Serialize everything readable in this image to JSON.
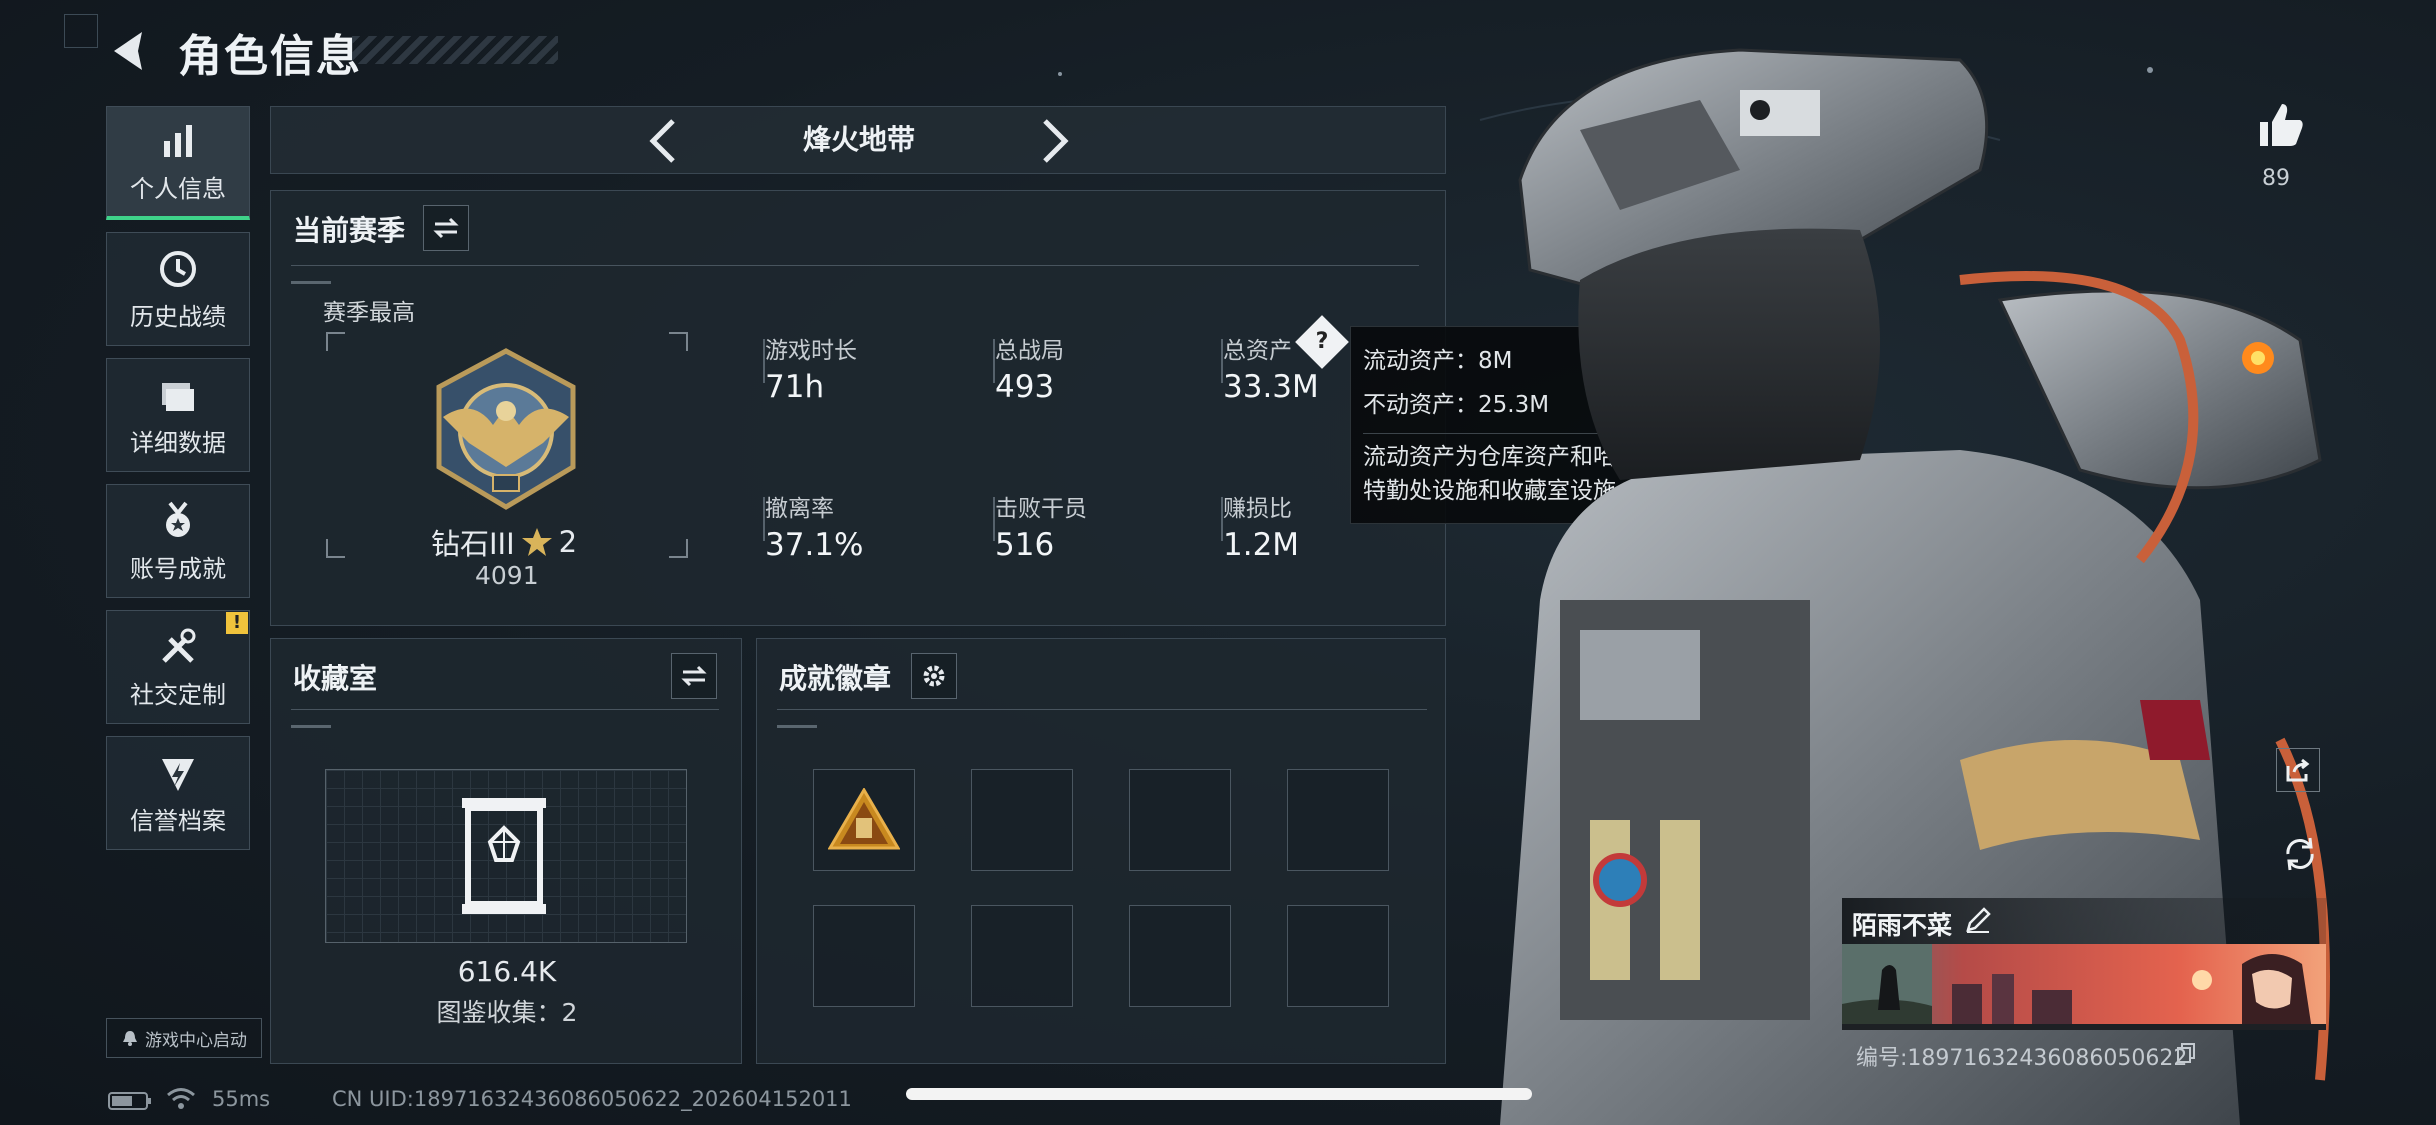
{
  "header": {
    "title": "角色信息"
  },
  "sidebar": {
    "items": [
      {
        "label": "个人信息",
        "icon": "bar-chart-icon",
        "active": true
      },
      {
        "label": "历史战绩",
        "icon": "history-icon"
      },
      {
        "label": "详细数据",
        "icon": "folder-icon"
      },
      {
        "label": "账号成就",
        "icon": "medal-icon"
      },
      {
        "label": "社交定制",
        "icon": "tools-icon",
        "badge": "!"
      },
      {
        "label": "信誉档案",
        "icon": "credit-shield-icon"
      }
    ],
    "game_center": "游戏中心启动"
  },
  "mode_selector": {
    "title": "烽火地带"
  },
  "season": {
    "header": "当前赛季",
    "best_label": "赛季最高",
    "rank_name": "钻石III",
    "rank_stars": "2",
    "rank_points": "4091",
    "stats": [
      {
        "label": "游戏时长",
        "value": "71h"
      },
      {
        "label": "总战局",
        "value": "493"
      },
      {
        "label": "总资产",
        "value": "33.3M"
      },
      {
        "label": "撤离率",
        "value": "37.1%"
      },
      {
        "label": "击败干员",
        "value": "516"
      },
      {
        "label": "赚损比",
        "value": "1.2M"
      }
    ]
  },
  "tooltip": {
    "line1": "流动资产：8M",
    "line2": "不动资产：25.3M",
    "line3": "流动资产为仓库资产和哈夫币，不动资产为",
    "line4": "特勤处设施和收藏室设施"
  },
  "collection": {
    "header": "收藏室",
    "value": "616.4K",
    "count_text": "图鉴收集：2"
  },
  "achievements": {
    "header": "成就徽章"
  },
  "profile": {
    "likes": "89",
    "name": "陌雨不菜",
    "number": "编号:18971632436086050622"
  },
  "status_bar": {
    "latency": "55ms",
    "uid": "CN UID:18971632436086050622_202604152011"
  },
  "colors": {
    "accent_green": "#3fd38a",
    "badge_yellow": "#f0c33c",
    "ring_red": "#e34a3c"
  }
}
